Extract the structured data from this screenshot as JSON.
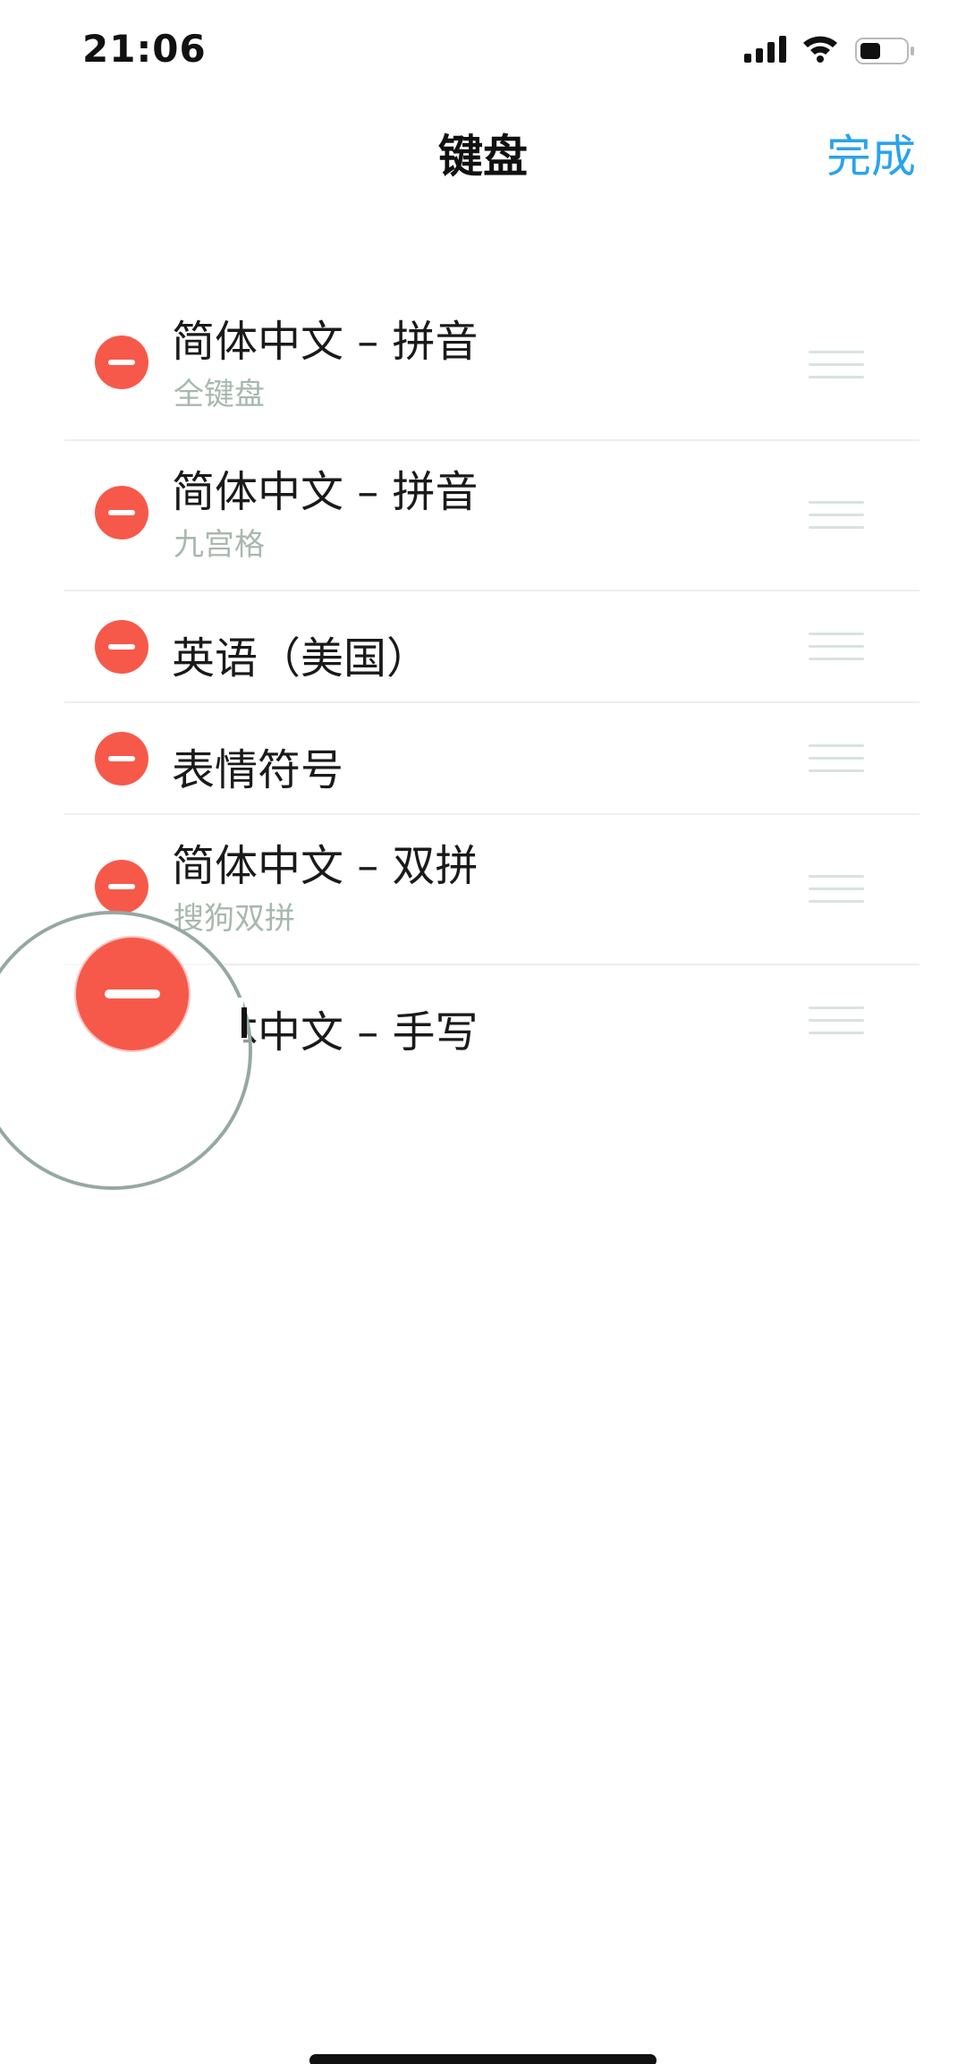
{
  "status_bar": {
    "time": "21:06",
    "icons": [
      "signal-icon",
      "wifi-icon",
      "battery-icon"
    ]
  },
  "nav": {
    "title": "键盘",
    "done_label": "完成"
  },
  "keyboards": [
    {
      "title": "简体中文 – 拼音",
      "subtitle": "全键盘"
    },
    {
      "title": "简体中文 – 拼音",
      "subtitle": "九宫格"
    },
    {
      "title": "英语（美国）",
      "subtitle": ""
    },
    {
      "title": "表情符号",
      "subtitle": ""
    },
    {
      "title": "简体中文 – 双拼",
      "subtitle": "搜狗双拼"
    },
    {
      "title": "简体中文 – 手写",
      "subtitle": ""
    }
  ],
  "colors": {
    "accent": "#2aa3ee",
    "delete": "#f6594a",
    "subtitle": "#a8b8ae",
    "separator": "#eeeeee"
  }
}
